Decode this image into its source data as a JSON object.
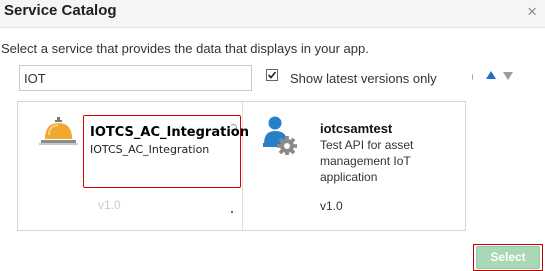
{
  "dialog": {
    "title": "Service Catalog",
    "close_icon": "×"
  },
  "instructions": "Select a service that provides the data that displays in your app.",
  "search": {
    "value": "IOT"
  },
  "filters": {
    "show_latest_label": "Show latest versions only",
    "show_latest_checked": true
  },
  "icons": {
    "sort_asc": "sort-ascending-icon",
    "sort_desc": "sort-descending-icon",
    "bell": "service-bell-icon",
    "service": "service-user-gear-icon"
  },
  "services": [
    {
      "title": "IOTCS_AC_Integration",
      "description": "IOTCS_AC_Integration",
      "version": "v1.0",
      "selected": true
    },
    {
      "title": "iotcsamtest",
      "description": "Test API for asset management IoT application",
      "version": "v1.0",
      "selected": false
    }
  ],
  "footer": {
    "select_label": "Select"
  },
  "colors": {
    "accent_blue": "#1f6fc5",
    "selection_red": "#d60000",
    "select_button": "#a8d8b6",
    "bell_gold": "#f0a830"
  }
}
